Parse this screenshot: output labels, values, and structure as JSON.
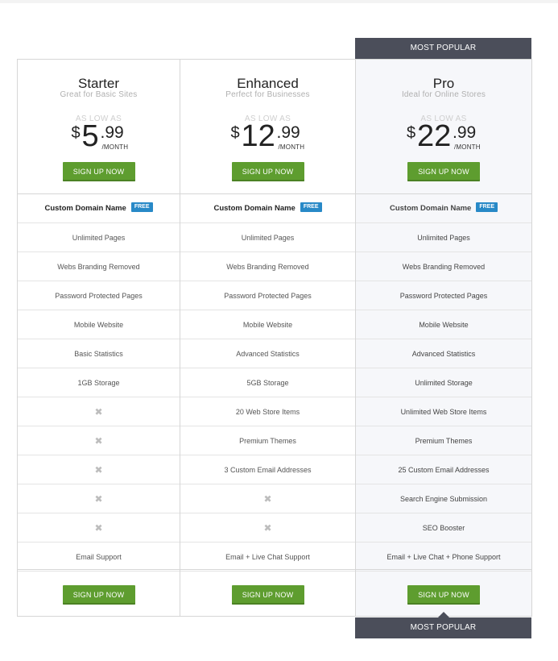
{
  "banner": {
    "most_popular": "MOST POPULAR"
  },
  "plans": [
    {
      "name": "Starter",
      "tagline": "Great for Basic Sites",
      "as_low_as": "AS LOW AS",
      "currency": "$",
      "price_whole": "5",
      "price_cents": ".99",
      "per": "/MONTH",
      "button": "SIGN UP NOW",
      "features": [
        "Custom Domain Name",
        "Unlimited Pages",
        "Webs Branding Removed",
        "Password Protected Pages",
        "Mobile Website",
        "Basic Statistics",
        "1GB Storage",
        "",
        "",
        "",
        "",
        "",
        "Email Support"
      ],
      "free_badge": "FREE",
      "footer_button": "SIGN UP NOW"
    },
    {
      "name": "Enhanced",
      "tagline": "Perfect for Businesses",
      "as_low_as": "AS LOW AS",
      "currency": "$",
      "price_whole": "12",
      "price_cents": ".99",
      "per": "/MONTH",
      "button": "SIGN UP NOW",
      "features": [
        "Custom Domain Name",
        "Unlimited Pages",
        "Webs Branding Removed",
        "Password Protected Pages",
        "Mobile Website",
        "Advanced Statistics",
        "5GB Storage",
        "20 Web Store Items",
        "Premium Themes",
        "3 Custom Email Addresses",
        "",
        "",
        "Email + Live Chat Support"
      ],
      "free_badge": "FREE",
      "footer_button": "SIGN UP NOW"
    },
    {
      "name": "Pro",
      "tagline": "Ideal for Online Stores",
      "as_low_as": "AS LOW AS",
      "currency": "$",
      "price_whole": "22",
      "price_cents": ".99",
      "per": "/MONTH",
      "button": "SIGN UP NOW",
      "features": [
        "Custom Domain Name",
        "Unlimited Pages",
        "Webs Branding Removed",
        "Password Protected Pages",
        "Mobile Website",
        "Advanced Statistics",
        "Unlimited Storage",
        "Unlimited Web Store Items",
        "Premium Themes",
        "25 Custom Email Addresses",
        "Search Engine Submission",
        "SEO Booster",
        "Email + Live Chat + Phone Support"
      ],
      "free_badge": "FREE",
      "footer_button": "SIGN UP NOW"
    }
  ],
  "colors": {
    "button": "#5e9d2f",
    "badge": "#2889c7",
    "banner": "#4b4e5a",
    "pro_bg": "#f6f7fa"
  },
  "icons": {
    "not_included": "x-mark-icon"
  }
}
